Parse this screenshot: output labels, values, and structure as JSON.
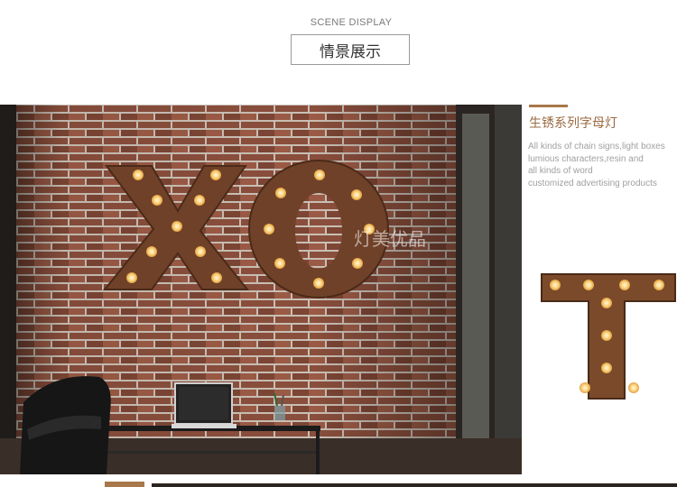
{
  "header": {
    "subtitle": "SCENE DISPLAY",
    "title": "情景展示"
  },
  "scene": {
    "watermark": "灯美优品"
  },
  "side_panel": {
    "title": "生锈系列字母灯",
    "description_lines": [
      "All kinds of chain signs,light boxes",
      "lumious characters,resin and",
      "all kinds of word",
      "customized advertising products"
    ]
  },
  "colors": {
    "accent": "#a8774a",
    "rust": "#7a4a2a",
    "bulb": "#ffe6a8"
  }
}
